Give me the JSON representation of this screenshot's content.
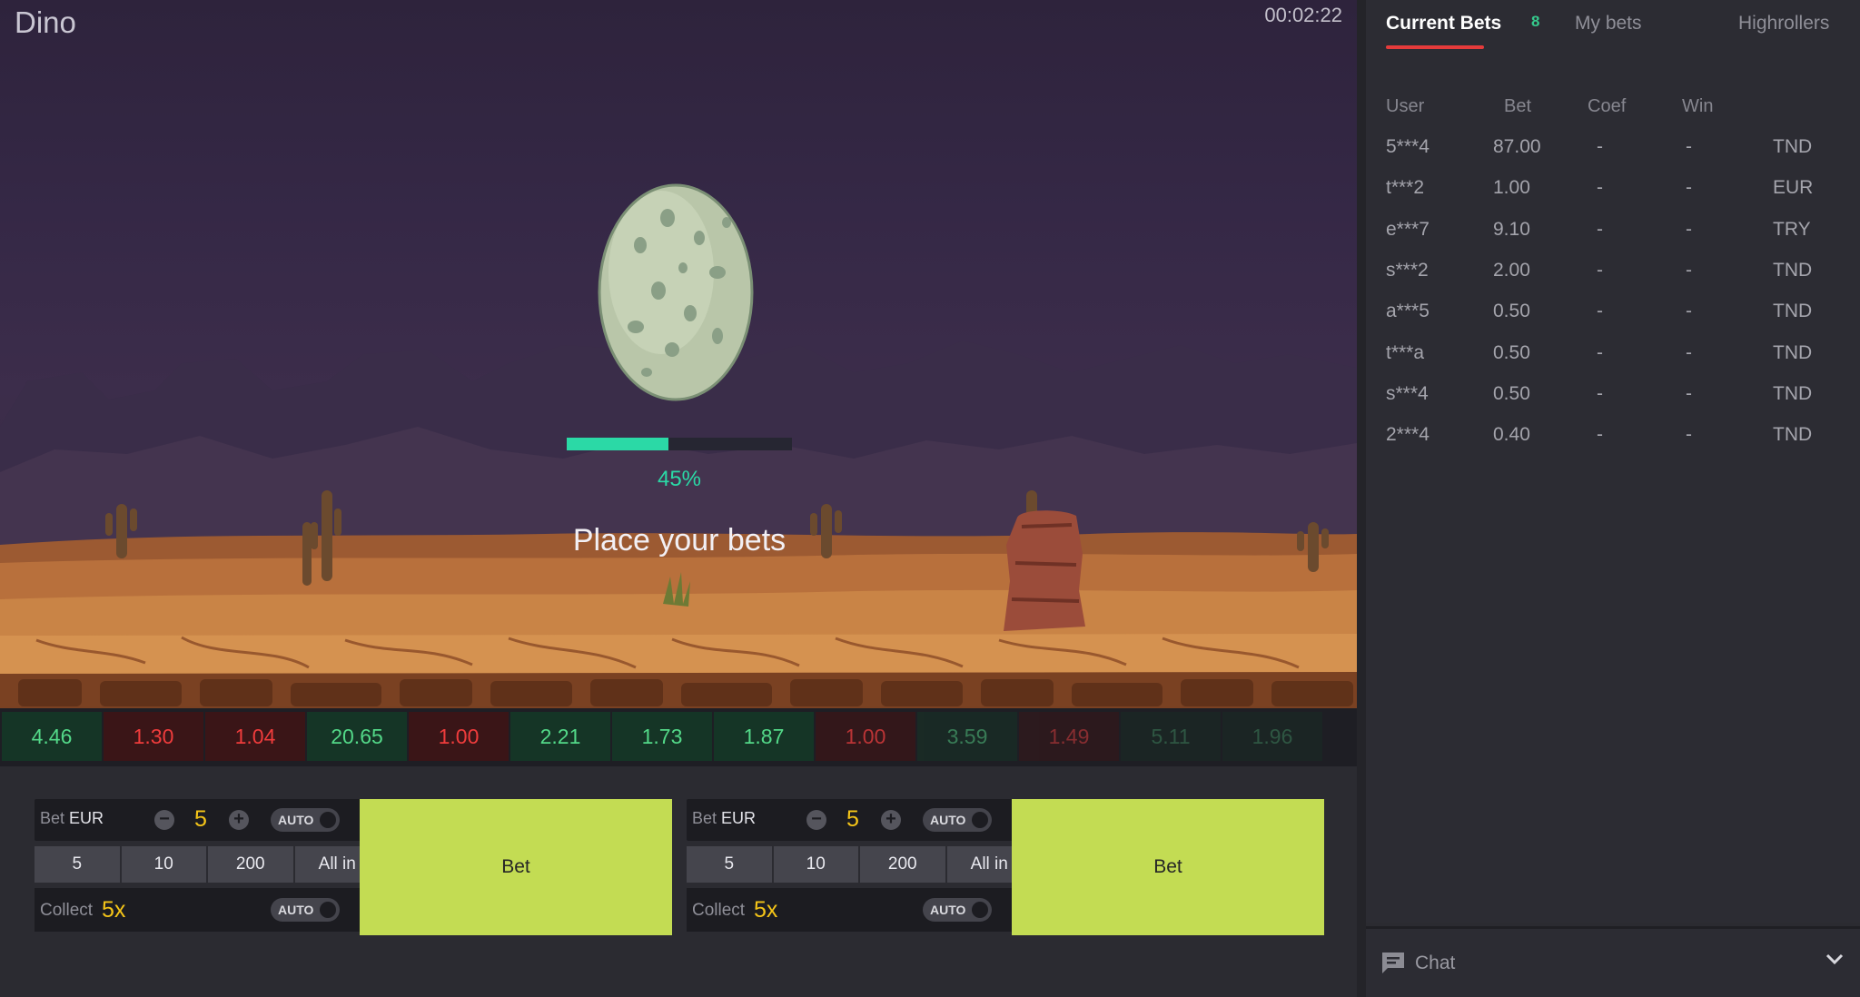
{
  "game": {
    "title": "Dino",
    "timer": "00:02:22",
    "progress_fraction": 0.45,
    "progress_label": "45%",
    "prompt": "Place your bets"
  },
  "history": [
    {
      "value": "4.46",
      "color": "green"
    },
    {
      "value": "1.30",
      "color": "red"
    },
    {
      "value": "1.04",
      "color": "red"
    },
    {
      "value": "20.65",
      "color": "green"
    },
    {
      "value": "1.00",
      "color": "red"
    },
    {
      "value": "2.21",
      "color": "green"
    },
    {
      "value": "1.73",
      "color": "green"
    },
    {
      "value": "1.87",
      "color": "green"
    },
    {
      "value": "1.00",
      "color": "red"
    },
    {
      "value": "3.59",
      "color": "green"
    },
    {
      "value": "1.49",
      "color": "red"
    },
    {
      "value": "5.11",
      "color": "green"
    },
    {
      "value": "1.96",
      "color": "green"
    }
  ],
  "bet_panels": [
    {
      "bet_label": "Bet",
      "currency": "EUR",
      "amount": "5",
      "auto_label": "AUTO",
      "quick": [
        "5",
        "10",
        "200",
        "All in"
      ],
      "collect_label": "Collect",
      "collect_value": "5x",
      "bet_button": "Bet"
    },
    {
      "bet_label": "Bet",
      "currency": "EUR",
      "amount": "5",
      "auto_label": "AUTO",
      "quick": [
        "5",
        "10",
        "200",
        "All in"
      ],
      "collect_label": "Collect",
      "collect_value": "5x",
      "bet_button": "Bet"
    }
  ],
  "sidebar": {
    "tabs": [
      {
        "label": "Current Bets",
        "count": "8",
        "active": true
      },
      {
        "label": "My bets",
        "active": false
      },
      {
        "label": "Highrollers",
        "active": false
      }
    ],
    "columns": [
      "User",
      "Bet",
      "Coef",
      "Win"
    ],
    "rows": [
      {
        "user": "5***4",
        "bet": "87.00",
        "coef": "-",
        "win": "-",
        "currency": "TND"
      },
      {
        "user": "t***2",
        "bet": "1.00",
        "coef": "-",
        "win": "-",
        "currency": "EUR"
      },
      {
        "user": "e***7",
        "bet": "9.10",
        "coef": "-",
        "win": "-",
        "currency": "TRY"
      },
      {
        "user": "s***2",
        "bet": "2.00",
        "coef": "-",
        "win": "-",
        "currency": "TND"
      },
      {
        "user": "a***5",
        "bet": "0.50",
        "coef": "-",
        "win": "-",
        "currency": "TND"
      },
      {
        "user": "t***a",
        "bet": "0.50",
        "coef": "-",
        "win": "-",
        "currency": "TND"
      },
      {
        "user": "s***4",
        "bet": "0.50",
        "coef": "-",
        "win": "-",
        "currency": "TND"
      },
      {
        "user": "2***4",
        "bet": "0.40",
        "coef": "-",
        "win": "-",
        "currency": "TND"
      }
    ],
    "chat_label": "Chat"
  },
  "colors": {
    "accent_green": "#2bd9a6",
    "bet_button": "#c3dc53",
    "amount_yellow": "#f5c518",
    "tab_underline": "#e53b3b",
    "history_green": "#53d888",
    "history_red": "#ef3c3c"
  }
}
